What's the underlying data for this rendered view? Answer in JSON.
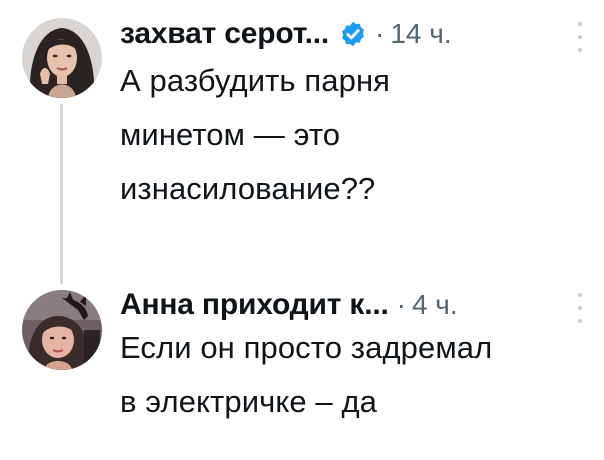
{
  "tweets": [
    {
      "author": "захват серот...",
      "verified": true,
      "separator": "·",
      "time": "14 ч.",
      "text": "А разбудить парня\nминетом — это\nизнасилование??",
      "avatar_icon": "avatar-woman-long-dark-hair",
      "more_icon": "more-dots-icon"
    },
    {
      "author": "Анна приходит к...",
      "verified": false,
      "separator": "·",
      "time": "4 ч.",
      "text": "Если он просто задремал\nв электричке – да",
      "avatar_icon": "avatar-woman-with-cat",
      "more_icon": "more-dots-icon"
    }
  ],
  "colors": {
    "text": "#0f1419",
    "muted": "#536471",
    "verified_blue": "#1d9bf0",
    "thread_line": "#cfd9de"
  }
}
